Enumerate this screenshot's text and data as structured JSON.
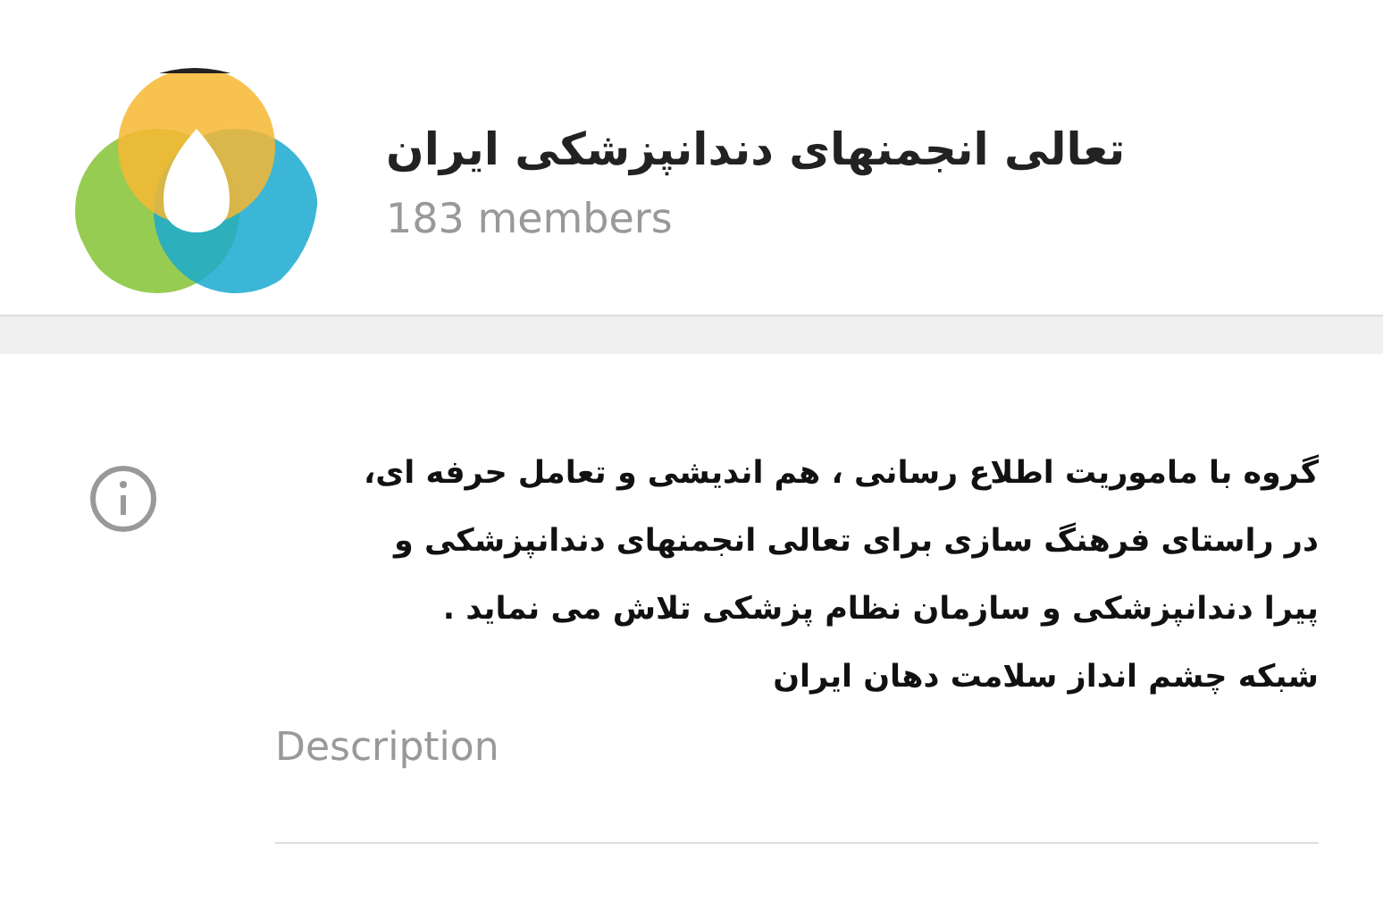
{
  "group": {
    "title": "تعالی انجمنهای دندانپزشکی ایران",
    "members": "183 members"
  },
  "info": {
    "description": "گروه با ماموریت اطلاع رسانی ، هم اندیشی و تعامل حرفه ای،\nدر راستای فرهنگ سازی برای تعالی انجمنهای دندانپزشکی و\nپیرا دندانپزشکی و سازمان نظام پزشکی تلاش می نماید .\nشبکه چشم انداز سلامت دهان ایران",
    "label": "Description"
  }
}
